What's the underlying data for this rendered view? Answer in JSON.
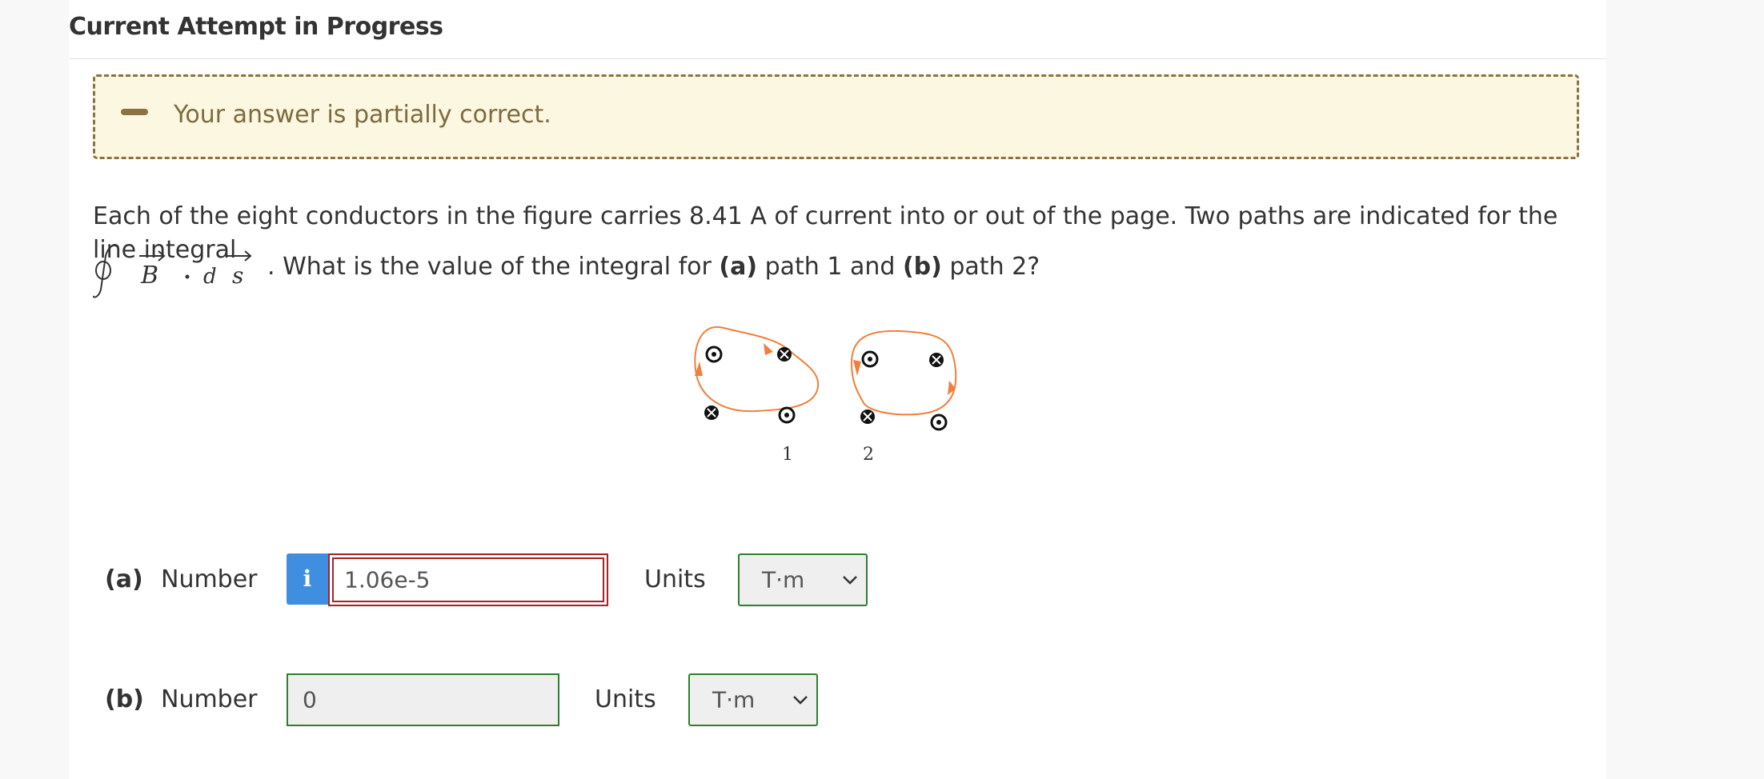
{
  "header": {
    "title": "Current Attempt in Progress"
  },
  "feedback": {
    "message": "Your answer is partially correct.",
    "accent_color": "#8a7340"
  },
  "question": {
    "line1": "Each of the eight conductors in the figure carries 8.41 A of current into or out of the page. Two paths are indicated for the line integral",
    "line2_prefix": ". What is the value of the integral for ",
    "part_a_tag": "(a)",
    "mid": " path 1 and ",
    "part_b_tag": "(b)",
    "suffix": " path 2?",
    "integral_B": "B",
    "integral_d": "d",
    "integral_s": "s"
  },
  "figure": {
    "path1_label": "1",
    "path2_label": "2"
  },
  "parts": [
    {
      "id": "(a)",
      "label": "Number",
      "value": "1.06e-5",
      "status": "incorrect",
      "units_label": "Units",
      "unit": "T·m"
    },
    {
      "id": "(b)",
      "label": "Number",
      "value": "0",
      "status": "correct",
      "units_label": "Units",
      "unit": "T·m"
    }
  ],
  "info_icon": {
    "glyph": "i",
    "icon": "info-icon"
  },
  "colors": {
    "correct": "#2e7d32",
    "incorrect": "#a72222",
    "info": "#3f8ee0",
    "path": "#f07f3c"
  }
}
